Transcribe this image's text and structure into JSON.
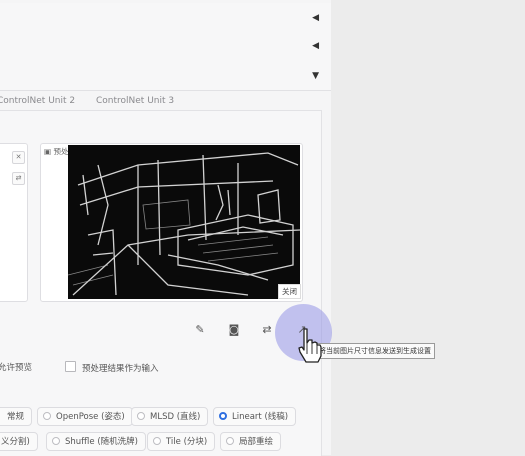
{
  "panel": {
    "collapsed_rows": [
      {
        "arrow": "◀"
      },
      {
        "arrow": "◀"
      },
      {
        "arrow": "▼"
      }
    ],
    "tabs": [
      {
        "label": "ControlNet Unit 2"
      },
      {
        "label": "ControlNet Unit 3"
      }
    ]
  },
  "preview": {
    "label": "预处理结果预览",
    "close_label": "关闭",
    "left_box_icons": [
      "close-icon",
      "swap-icon"
    ],
    "download_icon": "download-icon"
  },
  "toolbar": {
    "icons": [
      "edit-icon",
      "camera-icon",
      "swap-arrows-icon",
      "send-size-icon"
    ],
    "tooltip": "将当前图片尺寸信息发送到生成设置"
  },
  "options": {
    "allow_preview": "允许预览",
    "preview_as_input": "预处理结果作为输入"
  },
  "control_types": {
    "row1": [
      {
        "label": "常规",
        "selected": false,
        "radio": false
      },
      {
        "label": "OpenPose (姿态)",
        "selected": false,
        "radio": true
      },
      {
        "label": "MLSD (直线)",
        "selected": false,
        "radio": true
      },
      {
        "label": "Lineart (线稿)",
        "selected": true,
        "radio": true
      }
    ],
    "row2": [
      {
        "label": "义分割)",
        "selected": false,
        "radio": false
      },
      {
        "label": "Shuffle (随机洗牌)",
        "selected": false,
        "radio": true
      },
      {
        "label": "Tile (分块)",
        "selected": false,
        "radio": true
      },
      {
        "label": "局部重绘",
        "selected": false,
        "radio": true
      }
    ]
  },
  "colors": {
    "accent": "#2f6fe0",
    "halo": "#9696e6"
  }
}
